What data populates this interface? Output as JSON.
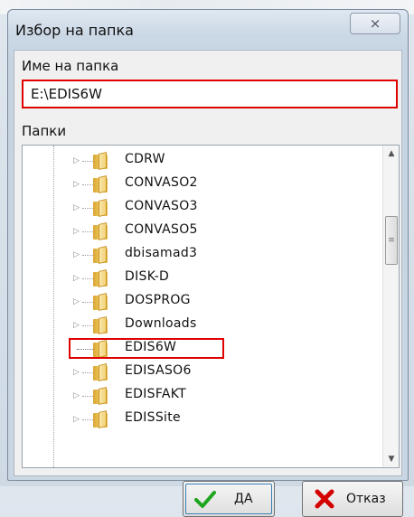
{
  "window": {
    "title": "Избор на папка",
    "close_symbol": "⨯"
  },
  "folder_name": {
    "label": "Име на папка",
    "value": "E:\\EDIS6W"
  },
  "folders": {
    "label": "Папки",
    "items": [
      {
        "label": "CDRW",
        "expandable": true
      },
      {
        "label": "CONVASO2",
        "expandable": true
      },
      {
        "label": "CONVASO3",
        "expandable": true
      },
      {
        "label": "CONVASO5",
        "expandable": true
      },
      {
        "label": "dbisamad3",
        "expandable": true
      },
      {
        "label": "DISK-D",
        "expandable": true
      },
      {
        "label": "DOSPROG",
        "expandable": true
      },
      {
        "label": "Downloads",
        "expandable": true
      },
      {
        "label": "EDIS6W",
        "expandable": false,
        "selected": true
      },
      {
        "label": "EDISASO6",
        "expandable": true
      },
      {
        "label": "EDISFAKT",
        "expandable": true
      },
      {
        "label": "EDISSite",
        "expandable": true
      }
    ]
  },
  "buttons": {
    "ok_label": "ДА",
    "cancel_label": "Отказ"
  },
  "colors": {
    "highlight": "#e00000",
    "ok_check": "#1ea51e",
    "cancel_x": "#d40000"
  },
  "icons": {
    "folder": "folder-icon",
    "expand": "chevron-right-icon",
    "ok": "checkmark-icon",
    "cancel": "x-icon"
  }
}
